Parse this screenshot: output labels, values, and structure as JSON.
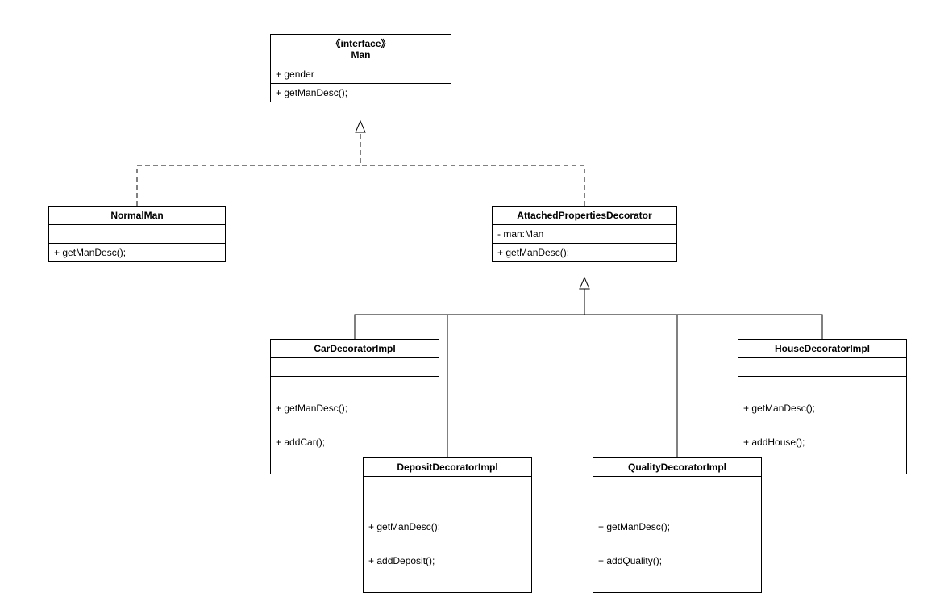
{
  "top_interface": {
    "stereotype": "《interface》",
    "name": "Man",
    "attribute": "+ gender",
    "method": "+ getManDesc();"
  },
  "normal_man": {
    "name": "NormalMan",
    "method": "+ getManDesc();"
  },
  "decorator": {
    "name": "AttachedPropertiesDecorator",
    "attribute": "- man:Man",
    "method": "+ getManDesc();"
  },
  "car_decorator": {
    "name": "CarDecoratorImpl",
    "method1": "+ getManDesc();",
    "method2": "+ addCar();"
  },
  "house_decorator": {
    "name": "HouseDecoratorImpl",
    "method1": "+ getManDesc();",
    "method2": "+ addHouse();"
  },
  "deposit_decorator": {
    "name": "DepositDecoratorImpl",
    "method1": "+ getManDesc();",
    "method2": "+ addDeposit();"
  },
  "quality_decorator": {
    "name": "QualityDecoratorImpl",
    "method1": "+ getManDesc();",
    "method2": "+ addQuality();"
  }
}
